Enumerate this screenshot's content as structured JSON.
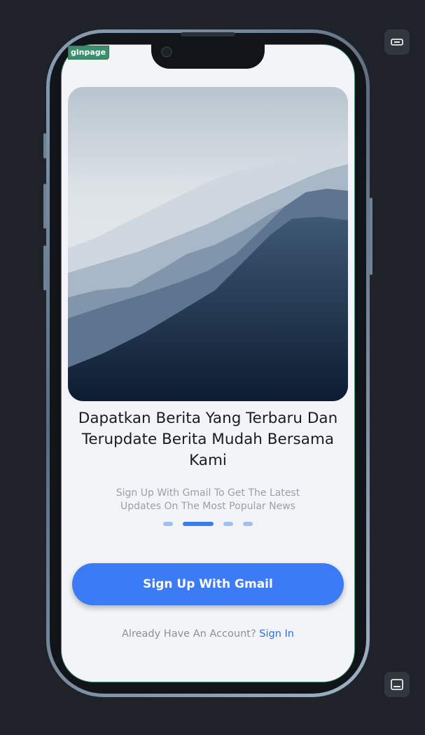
{
  "tag_label": "ginpage",
  "headline": "Dapatkan Berita Yang Terbaru Dan Terupdate Berita Mudah Bersama Kami",
  "subtitle": "Sign Up With Gmail To Get The Latest Updates On The Most Popular  News",
  "pagination": {
    "total": 4,
    "active_index": 1
  },
  "cta_label": "Sign Up With Gmail",
  "signin_prompt": "Already Have An Account?",
  "signin_link": "Sign In",
  "side_icons": {
    "top": "device-compact-icon",
    "bottom": "device-frame-icon"
  },
  "colors": {
    "primary": "#3b7cf6",
    "link": "#2f6fe0",
    "tag": "#3b8f6d",
    "background": "#1f2329",
    "screen": "#f2f4f7"
  }
}
